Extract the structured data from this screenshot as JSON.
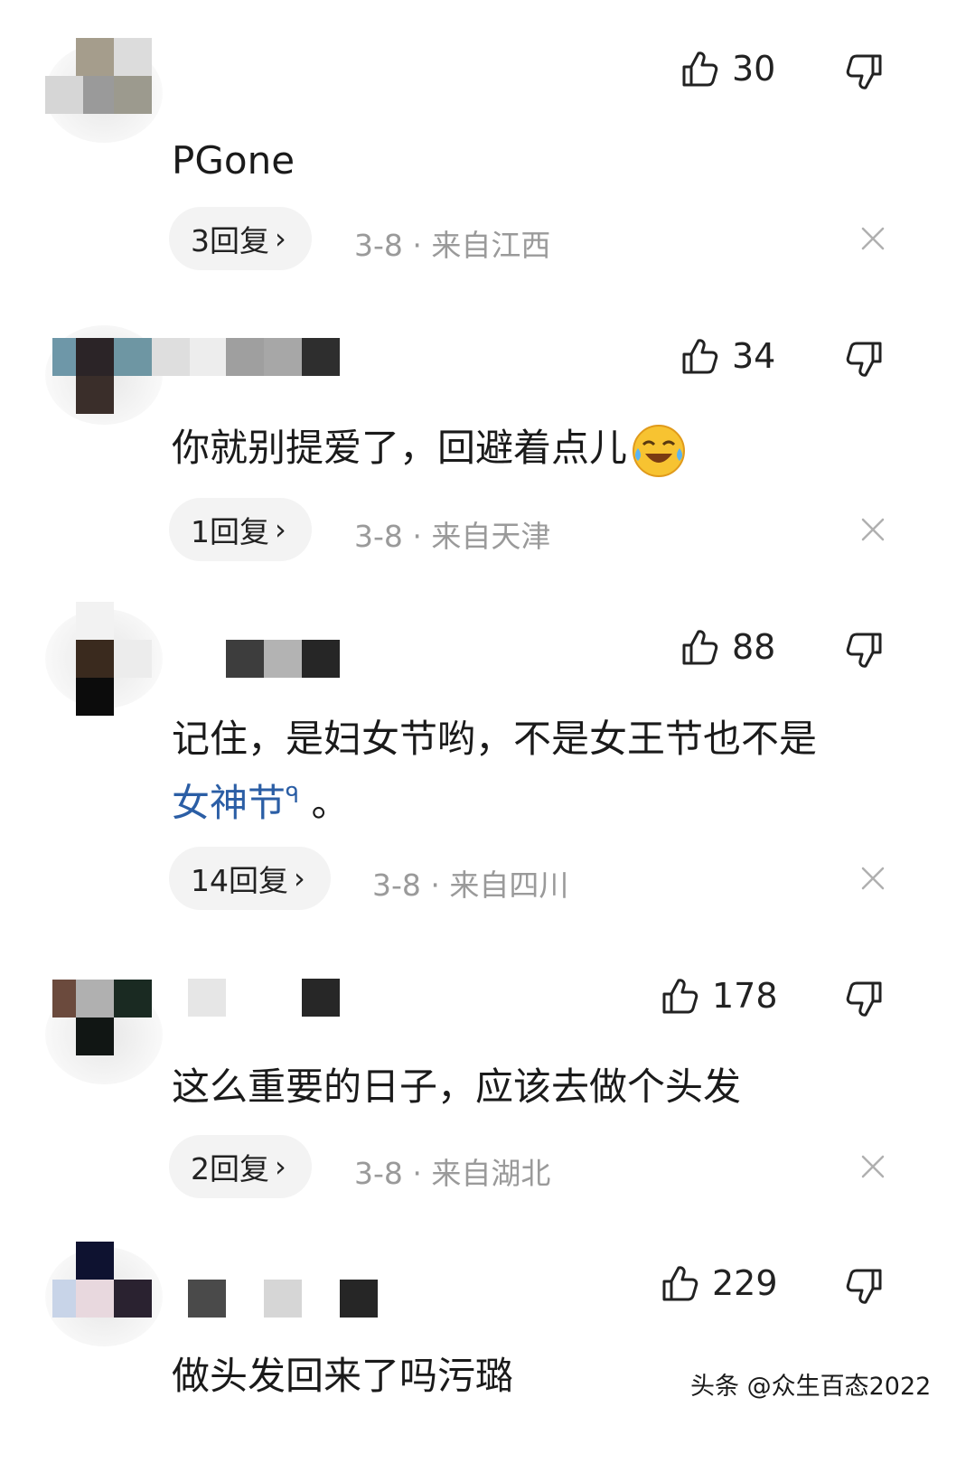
{
  "comments": [
    {
      "likes": "30",
      "text": "PGone",
      "replies": "3回复",
      "date": "3-8",
      "location": "来自江西"
    },
    {
      "likes": "34",
      "text": "你就别提爱了，回避着点儿",
      "replies": "1回复",
      "date": "3-8",
      "location": "来自天津"
    },
    {
      "likes": "88",
      "text": "记住，是妇女节哟，不是女王节也不是",
      "link_text": "女神节",
      "text_tail": "。",
      "replies": "14回复",
      "date": "3-8",
      "location": "来自四川"
    },
    {
      "likes": "178",
      "text": "这么重要的日子，应该去做个头发",
      "replies": "2回复",
      "date": "3-8",
      "location": "来自湖北"
    },
    {
      "likes": "229",
      "text": "做头发回来了吗污璐"
    }
  ],
  "meta_separator": "·",
  "watermark": "头条 @众生百态2022",
  "colors": {
    "link": "#2b5ea5",
    "pill_bg": "#f3f3f3",
    "meta": "#9a9a9a"
  }
}
